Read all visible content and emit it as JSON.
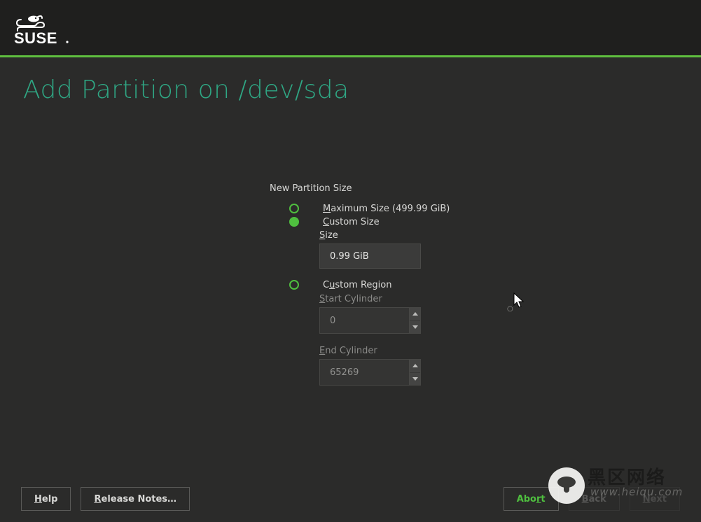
{
  "colors": {
    "accent": "#4fbf3f",
    "title": "#2fa784",
    "bg": "#2b2b2a"
  },
  "brand": "SUSE",
  "title_prefix": "Add Partition on ",
  "title_device": "/dev/sda",
  "form": {
    "group_label": "New Partition Size",
    "radios": {
      "max": {
        "label": "aximum Size (499.99 GiB)",
        "mnemonic": "M"
      },
      "custom_size": {
        "label": "ustom Size",
        "mnemonic": "C"
      },
      "custom_region": {
        "label": "stom Region",
        "mnemonic": "u",
        "prefix": "C"
      }
    },
    "size": {
      "label_mnemonic": "S",
      "label_rest": "ize",
      "value": "0.99 GiB"
    },
    "start_cyl": {
      "label_mnemonic": "S",
      "label_rest": "tart Cylinder",
      "value": "0"
    },
    "end_cyl": {
      "label_mnemonic": "E",
      "label_rest": "nd Cylinder",
      "value": "65269"
    }
  },
  "buttons": {
    "help": {
      "mnemonic": "H",
      "rest": "elp"
    },
    "release_notes": {
      "mnemonic": "R",
      "rest": "elease Notes...",
      "prefix": "",
      "text": "elease Notes…"
    },
    "abort": {
      "mnemonic": "r",
      "prefix": "Abo",
      "suffix": "t"
    },
    "back": {
      "mnemonic": "B",
      "rest": "ack"
    },
    "next": {
      "mnemonic": "N",
      "rest": "ext"
    }
  },
  "watermark": {
    "zh": "黑区网络",
    "en": "www.heiqu.com"
  }
}
